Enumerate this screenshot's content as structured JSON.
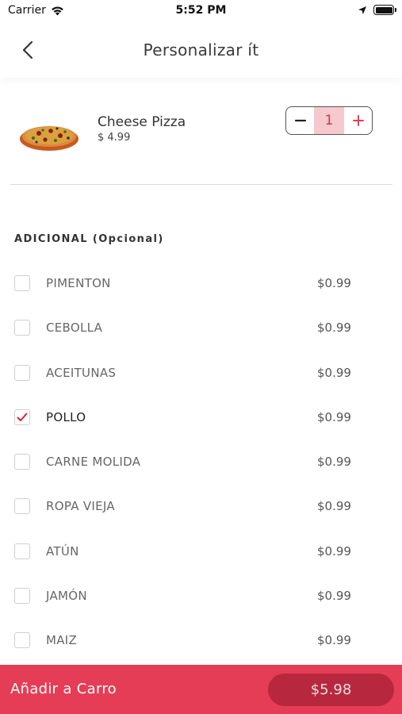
{
  "status_bar": {
    "carrier": "Carrier",
    "time": "5:52 PM",
    "battery_level": 1.0
  },
  "nav": {
    "title": "Personalizar ít"
  },
  "product": {
    "name": "Cheese Pizza",
    "price": "$ 4.99",
    "quantity": "1"
  },
  "section": {
    "title": "ADICIONAL (Opcional)"
  },
  "options": [
    {
      "label": "PIMENTON",
      "price": "$0.99",
      "checked": false
    },
    {
      "label": "CEBOLLA",
      "price": "$0.99",
      "checked": false
    },
    {
      "label": "ACEITUNAS",
      "price": "$0.99",
      "checked": false
    },
    {
      "label": "POLLO",
      "price": "$0.99",
      "checked": true
    },
    {
      "label": "CARNE MOLIDA",
      "price": "$0.99",
      "checked": false
    },
    {
      "label": "ROPA VIEJA",
      "price": "$0.99",
      "checked": false
    },
    {
      "label": "ATÚN",
      "price": "$0.99",
      "checked": false
    },
    {
      "label": "JAMÓN",
      "price": "$0.99",
      "checked": false
    },
    {
      "label": "MAIZ",
      "price": "$0.99",
      "checked": false
    }
  ],
  "footer": {
    "add_label": "Añadir a Carro",
    "total": "$5.98"
  },
  "colors": {
    "accent": "#e53d55",
    "accent_dark": "#b7283f",
    "checkmark": "#d81e3a"
  },
  "icons": {
    "back": "chevron-left-icon",
    "wifi": "wifi-icon",
    "location": "location-arrow-icon",
    "battery": "battery-icon",
    "minus": "minus-icon",
    "plus": "plus-icon",
    "check": "checkmark-icon"
  }
}
